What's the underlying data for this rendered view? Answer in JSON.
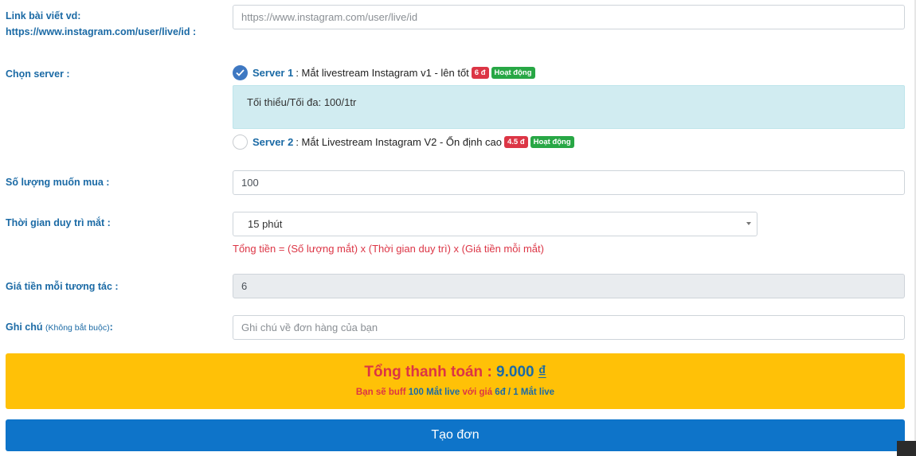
{
  "link": {
    "label_line1": "Link bài viết vd:",
    "label_line2": "https://www.instagram.com/user/live/id :",
    "placeholder": "https://www.instagram.com/user/live/id"
  },
  "server": {
    "label": "Chọn server :",
    "options": [
      {
        "name": "Server 1",
        "desc": ": Mắt livestream Instagram v1 - lên tốt",
        "price": "6 đ",
        "status": "Hoạt động",
        "checked": true
      },
      {
        "name": "Server 2",
        "desc": ": Mắt Livestream Instagram V2 - Ổn định cao",
        "price": "4.5 đ",
        "status": "Hoạt động",
        "checked": false
      }
    ],
    "info": "Tối thiểu/Tối đa: 100/1tr"
  },
  "quantity": {
    "label": "Số lượng muốn mua :",
    "value": "100"
  },
  "duration": {
    "label": "Thời gian duy trì mắt :",
    "selected": "15 phút",
    "formula": "Tổng tiền = (Số lượng mắt) x (Thời gian duy trì) x (Giá tiền mỗi mắt)"
  },
  "unit_price": {
    "label": "Giá tiền mỗi tương tác :",
    "value": "6"
  },
  "note": {
    "label": "Ghi chú",
    "label_hint": "(Không bắt buộc)",
    "label_colon": ":",
    "placeholder": "Ghi chú về đơn hàng của bạn"
  },
  "total": {
    "label": "Tổng thanh toán :",
    "amount": "9.000",
    "currency": "₫",
    "sub_prefix": "Bạn sẽ buff",
    "sub_qty": "100 Mắt live",
    "sub_mid": "với giá",
    "sub_price": "6đ / 1 Mắt live"
  },
  "submit_label": "Tạo đơn",
  "colors": {
    "label_blue": "#1b6aa5",
    "red": "#dc3545",
    "green": "#28a745",
    "yellow": "#ffc107",
    "button_blue": "#0e74c9",
    "info_bg": "#d1ecf1"
  }
}
